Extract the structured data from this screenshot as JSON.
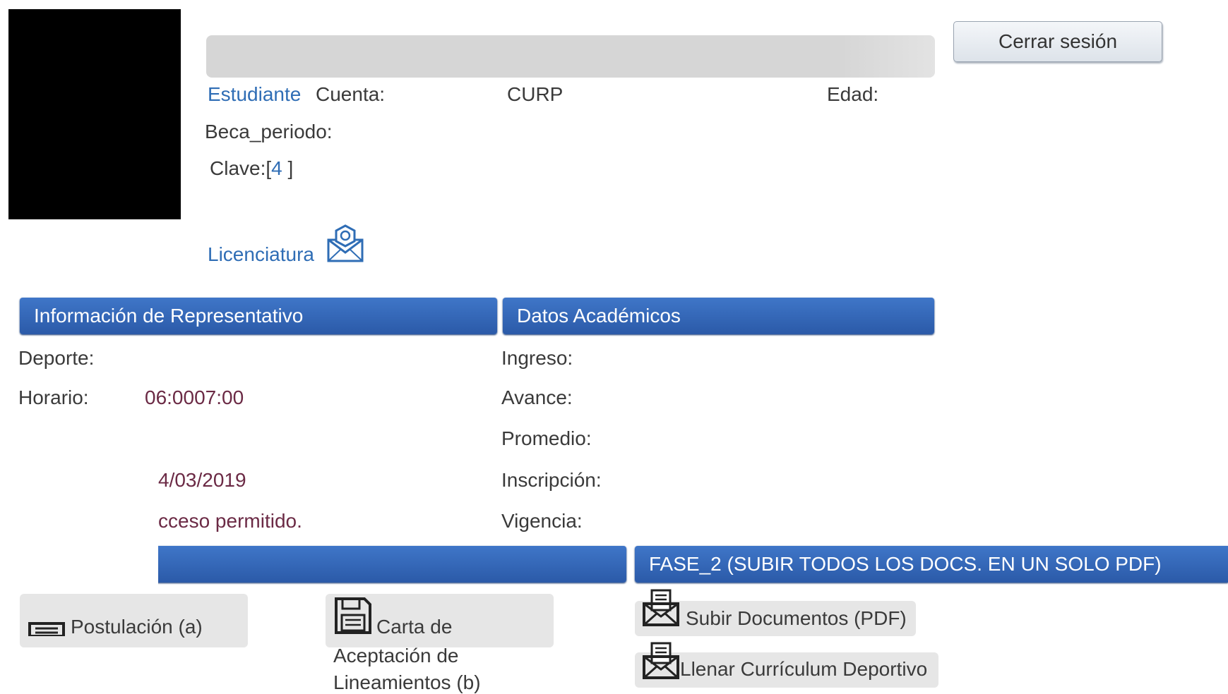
{
  "header": {
    "logout_label": "Cerrar sesión",
    "role_label": "Estudiante",
    "account_label": "Cuenta:",
    "curp_label": "CURP",
    "age_label": "Edad:",
    "scholarship_label": "Beca_periodo:",
    "key_label": "Clave:[",
    "key_value": "4",
    "key_close": "]",
    "degree_link": "Licenciatura"
  },
  "representative": {
    "title": "Información de Representativo",
    "sport_label": "Deporte:",
    "schedule_label": "Horario:",
    "schedule_value": "06:0007:00",
    "date_value": "4/03/2019",
    "access_value": "cceso permitido."
  },
  "academic": {
    "title": "Datos Académicos",
    "fields": [
      "Ingreso:",
      "Avance:",
      "Promedio:",
      "Inscripción:",
      "Vigencia:"
    ]
  },
  "phase1": {
    "postulation_label": "Postulación (a)",
    "letter_label_1": "Carta de",
    "letter_label_2": "Aceptación de",
    "letter_label_3": "Lineamientos (b)"
  },
  "phase2": {
    "title": "FASE_2 (SUBIR TODOS LOS DOCS. EN UN SOLO PDF)",
    "upload_label": "Subir Documentos (PDF)",
    "cv_label": "Llenar Currículum Deportivo"
  },
  "colors": {
    "header_blue": "#2f62b0",
    "link_blue": "#2f6db5",
    "value_maroon": "#6b2a45"
  },
  "icons": [
    "envelope-badge-icon",
    "floppy-disk-icon",
    "envelope-document-icon"
  ]
}
